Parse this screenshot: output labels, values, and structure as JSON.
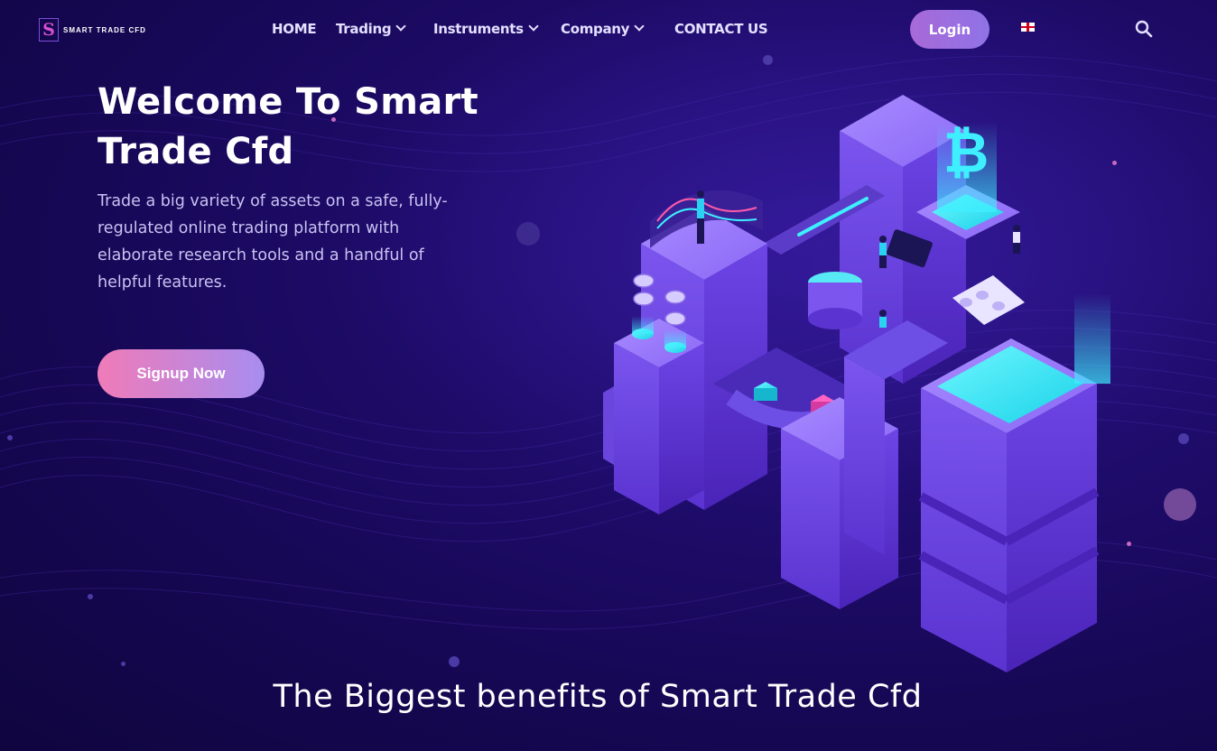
{
  "nav": {
    "logo_text": "SMART TRADE CFD",
    "logo_letter": "S",
    "items": [
      {
        "label": "HOME"
      },
      {
        "label": "Trading"
      },
      {
        "label": "Instruments"
      },
      {
        "label": "Company"
      },
      {
        "label": "CONTACT US"
      }
    ],
    "login_label": "Login",
    "language": "English",
    "search_icon": "search-icon"
  },
  "hero": {
    "title": "Welcome To Smart Trade Cfd",
    "subtitle": "Trade a big variety of assets on a safe, fully-regulated online trading platform with elaborate research tools and a handful of helpful features.",
    "cta_label": "Signup Now",
    "illustration_icon": "bitcoin-icon",
    "bitcoin_symbol": "₿"
  },
  "section": {
    "title": "The Biggest benefits of Smart Trade Cfd"
  },
  "colors": {
    "background": "#15084f",
    "accent_pink": "#f07bb8",
    "accent_purple": "#8f73e6",
    "cyan": "#1de9f0"
  }
}
